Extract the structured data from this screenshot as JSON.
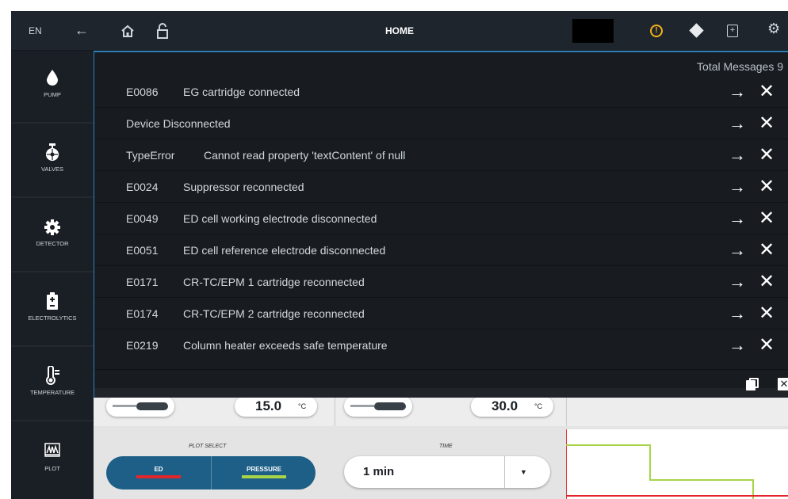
{
  "topbar": {
    "language": "EN",
    "title": "HOME",
    "warning_icon": "warning-circle-icon",
    "colors": {
      "warning": "#f2b21a",
      "accent": "#2f7fb5"
    }
  },
  "sidebar": {
    "items": [
      {
        "label": "PUMP",
        "icon": "droplet-icon"
      },
      {
        "label": "VALVES",
        "icon": "valve-icon"
      },
      {
        "label": "DETECTOR",
        "icon": "gear-icon"
      },
      {
        "label": "ELECTROLYTICS",
        "icon": "battery-icon"
      },
      {
        "label": "TEMPERATURE",
        "icon": "thermometer-icon"
      },
      {
        "label": "PLOT",
        "icon": "waveform-icon"
      }
    ]
  },
  "messages": {
    "total_label": "Total Messages 9",
    "items": [
      {
        "code": "E0086",
        "text": "EG cartridge connected"
      },
      {
        "code": "",
        "text": "Device Disconnected"
      },
      {
        "code": "TypeError",
        "text": "Cannot read property 'textContent' of null"
      },
      {
        "code": "E0024",
        "text": "Suppressor reconnected"
      },
      {
        "code": "E0049",
        "text": "ED cell working electrode disconnected"
      },
      {
        "code": "E0051",
        "text": "ED cell reference electrode disconnected"
      },
      {
        "code": "E0171",
        "text": "CR-TC/EPM 1 cartridge reconnected"
      },
      {
        "code": "E0174",
        "text": "CR-TC/EPM 2 cartridge reconnected"
      },
      {
        "code": "E0219",
        "text": "Column heater exceeds safe temperature"
      }
    ],
    "arrow_glyph": "→",
    "close_glyph": "✕"
  },
  "home": {
    "temps": [
      {
        "value": "15.0",
        "unit": "°C"
      },
      {
        "value": "30.0",
        "unit": "°C"
      }
    ],
    "plot_select": {
      "label": "PLOT SELECT",
      "options": [
        {
          "label": "ED",
          "color": "#e3262b"
        },
        {
          "label": "PRESSURE",
          "color": "#a8d44a"
        }
      ]
    },
    "time": {
      "label": "TIME",
      "value": "1 min"
    }
  }
}
